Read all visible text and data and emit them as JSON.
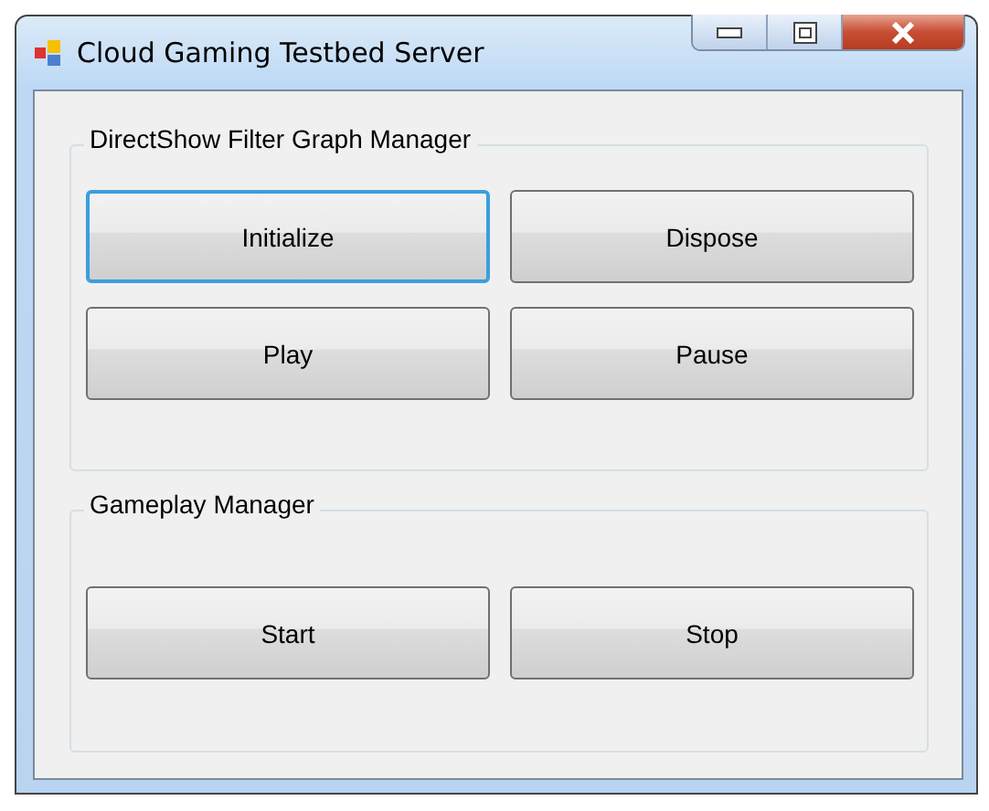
{
  "window": {
    "title": "Cloud Gaming Testbed Server"
  },
  "groups": [
    {
      "title": "DirectShow Filter Graph Manager",
      "buttons": [
        {
          "label": "Initialize",
          "focused": true
        },
        {
          "label": "Dispose",
          "focused": false
        },
        {
          "label": "Play",
          "focused": false
        },
        {
          "label": "Pause",
          "focused": false
        }
      ]
    },
    {
      "title": "Gameplay Manager",
      "buttons": [
        {
          "label": "Start",
          "focused": false
        },
        {
          "label": "Stop",
          "focused": false
        }
      ]
    }
  ]
}
